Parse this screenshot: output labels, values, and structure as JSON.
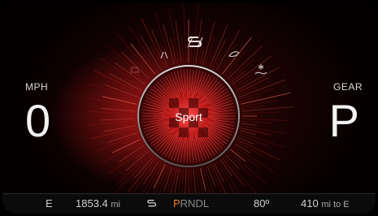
{
  "speed": {
    "unit_label": "MPH",
    "value": "0"
  },
  "gear": {
    "label": "GEAR",
    "value": "P"
  },
  "drive_mode": {
    "center_label": "Sport",
    "icons": [
      "off-road-icon",
      "sport-mode-icon",
      "eco-mode-icon",
      "snow-mode-icon",
      "tow-mode-icon"
    ]
  },
  "status_bar": {
    "fuel_empty_label": "E",
    "odometer_value": "1853.4",
    "odometer_unit": "mi",
    "prndl": {
      "active": "P",
      "inactive": "RNDL"
    },
    "temperature": "80º",
    "range_value": "410",
    "range_unit": "mi to E"
  },
  "colors": {
    "accent": "#c81a1a",
    "gear_active": "#f07a1a",
    "background": "#000000"
  }
}
